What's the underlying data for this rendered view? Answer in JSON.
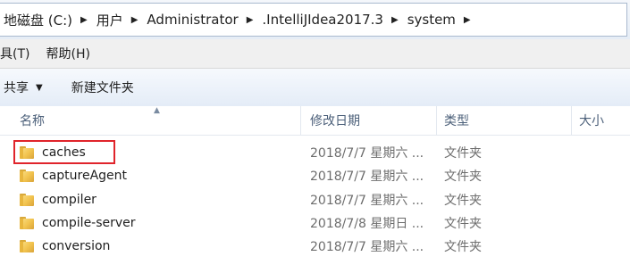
{
  "address_bar": {
    "crumbs": [
      "地磁盘 (C:)",
      "用户",
      "Administrator",
      ".IntelliJIdea2017.3",
      "system"
    ]
  },
  "menu": {
    "items": [
      "具(T)",
      "帮助(H)"
    ]
  },
  "toolbar": {
    "share_label": "共享",
    "new_folder_label": "新建文件夹"
  },
  "columns": {
    "name": "名称",
    "modified": "修改日期",
    "type": "类型",
    "size": "大小"
  },
  "files": [
    {
      "name": "caches",
      "modified": "2018/7/7 星期六 ...",
      "type": "文件夹",
      "highlighted": true
    },
    {
      "name": "captureAgent",
      "modified": "2018/7/7 星期六 ...",
      "type": "文件夹"
    },
    {
      "name": "compiler",
      "modified": "2018/7/7 星期六 ...",
      "type": "文件夹"
    },
    {
      "name": "compile-server",
      "modified": "2018/7/8 星期日 ...",
      "type": "文件夹"
    },
    {
      "name": "conversion",
      "modified": "2018/7/7 星期六 ...",
      "type": "文件夹"
    }
  ],
  "colors": {
    "highlight": "#e0242b",
    "folder": "#f2c44f"
  }
}
